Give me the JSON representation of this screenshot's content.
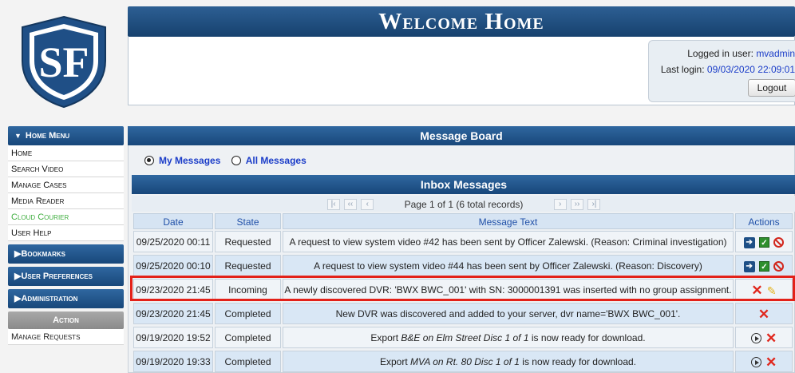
{
  "header": {
    "title": "Welcome Home",
    "logo_text": "SF",
    "logged_in_label": "Logged in user: ",
    "logged_in_user": "mvadmin",
    "last_login_label": "Last login: ",
    "last_login_value": "09/03/2020 22:09:01",
    "logout_label": "Logout"
  },
  "sidebar": {
    "home_menu_label": "Home Menu",
    "items": [
      {
        "label": "Home"
      },
      {
        "label": "Search Video"
      },
      {
        "label": "Manage Cases"
      },
      {
        "label": "Media Reader"
      },
      {
        "label": "Cloud Courier"
      },
      {
        "label": "User Help"
      }
    ],
    "bookmarks_label": "Bookmarks",
    "preferences_label": "User Preferences",
    "administration_label": "Administration",
    "action_label": "Action",
    "action_items": [
      {
        "label": "Manage Requests"
      }
    ]
  },
  "board": {
    "title": "Message Board",
    "radio_my": "My Messages",
    "radio_all": "All Messages",
    "selected": "My Messages",
    "inbox_title": "Inbox Messages",
    "pager_text": "Page 1 of 1 (6 total records)",
    "columns": {
      "date": "Date",
      "state": "State",
      "message": "Message Text",
      "actions": "Actions"
    },
    "rows": [
      {
        "date": "09/25/2020 00:11",
        "state": "Requested",
        "message": "A request to view system video #42 has been sent by Officer Zalewski. (Reason: Criminal investigation)",
        "actions": [
          "arrow-right-icon",
          "checkbox-icon",
          "ban-icon"
        ]
      },
      {
        "date": "09/25/2020 00:10",
        "state": "Requested",
        "message": "A request to view system video #44 has been sent by Officer Zalewski. (Reason: Discovery)",
        "actions": [
          "arrow-right-icon",
          "checkbox-icon",
          "ban-icon"
        ]
      },
      {
        "date": "09/23/2020 21:45",
        "state": "Incoming",
        "message": "A newly discovered DVR: 'BWX BWC_001' with SN: 3000001391 was inserted with no group assignment.",
        "actions": [
          "delete-icon",
          "pencil-icon"
        ]
      },
      {
        "date": "09/23/2020 21:45",
        "state": "Completed",
        "message": "New DVR was discovered and added to your server, dvr name='BWX BWC_001'.",
        "actions": [
          "delete-icon"
        ]
      },
      {
        "date": "09/19/2020 19:52",
        "state": "Completed",
        "message_prefix": "Export ",
        "message_italic": "B&E on Elm Street Disc 1 of 1",
        "message_suffix": " is now ready for download.",
        "actions": [
          "play-icon",
          "delete-icon"
        ]
      },
      {
        "date": "09/19/2020 19:33",
        "state": "Completed",
        "message_prefix": "Export ",
        "message_italic": "MVA on Rt. 80 Disc 1 of 1",
        "message_suffix": " is now ready for download.",
        "actions": [
          "play-icon",
          "delete-icon"
        ]
      }
    ]
  },
  "colors": {
    "header_blue": "#1e4e82",
    "highlight_red": "#e32119",
    "link_blue": "#1a3cc8",
    "cloud_courier_green": "#3fae3f"
  }
}
